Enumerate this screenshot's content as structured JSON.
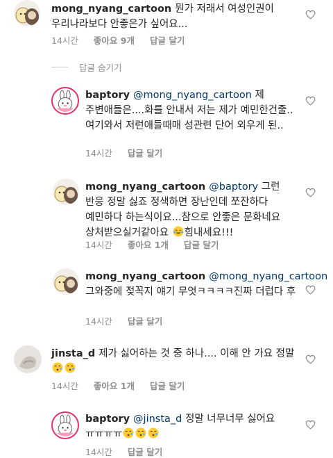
{
  "comments": [
    {
      "username": "mong_nyang_cartoon",
      "text": "뭔가 저래서 여성인권이 우리나라보다 안좋은가 싶어요...",
      "time": "14시간",
      "likes": "좋아요 9개",
      "reply": "답글 달기"
    }
  ],
  "hide_replies": "답글 숨기기",
  "replies": [
    {
      "username": "baptory",
      "mention": "@mong_nyang_cartoon",
      "text": "제 주변애들은....화를 안내서 저는 제가 예민한건줄.. 여기와서 저런애들때매 성관련 단어 외우게 된..",
      "time": "14시간",
      "likes": "",
      "reply": "답글 달기"
    },
    {
      "username": "mong_nyang_cartoon",
      "mention": "@baptory",
      "text": "그런 반응 정말 싫죠 정색하면 장난인데 쪼잔하다 예민하다 하는식이요...참으로 안좋은 문화네요 상처받으실거같아요",
      "text_after": "힘내세요!!!",
      "time": "14시간",
      "likes": "좋아요 1개",
      "reply": "답글 달기"
    },
    {
      "username": "mong_nyang_cartoon",
      "mention": "@mong_nyang_cartoon",
      "text": "그와중에 젖꼭지 얘기 무엇ㅋㅋㅋㅋ진짜 더럽다 후",
      "time": "14시간",
      "likes": "",
      "reply": "답글 달기"
    }
  ],
  "comment2": {
    "username": "jinsta_d",
    "text": "제가 싫어하는 것 중 하나.... 이해 안 가요 정말",
    "time": "14시간",
    "likes": "좋아요 1개",
    "reply": "답글 달기"
  },
  "reply5": {
    "username": "baptory",
    "mention": "@jinsta_d",
    "text": "정말 너무너무 싫어요 ㅠㅠㅠㅠ",
    "time": "14시간",
    "likes": "",
    "reply": "답글 달기"
  },
  "colors": {
    "mention": "#00376b",
    "meta": "#8e8e8e",
    "story_ring": "#e1306c"
  }
}
